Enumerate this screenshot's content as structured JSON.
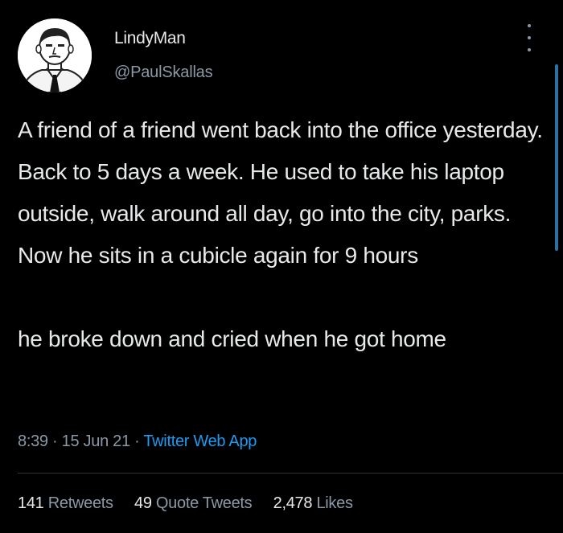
{
  "tweet": {
    "author": {
      "display_name": "LindyMan",
      "handle": "@PaulSkallas"
    },
    "paragraphs": [
      "A friend of a friend went back into the office yesterday. Back to 5 days a week. He used to take his laptop outside, walk around all day, go into the city, parks. Now he sits in a cubicle again for 9 hours",
      "he broke down and cried when he got home"
    ],
    "time": "8:39",
    "separator": "·",
    "date": "15 Jun 21",
    "source": "Twitter Web App",
    "stats": {
      "retweets": {
        "count": "141",
        "label": "Retweets"
      },
      "quote_tweets": {
        "count": "49",
        "label": "Quote Tweets"
      },
      "likes": {
        "count": "2,478",
        "label": "Likes"
      }
    }
  },
  "icons": {
    "more": "more-horizontal-icon",
    "avatar": "cartoon-man-avatar"
  },
  "colors": {
    "background": "#000000",
    "text": "#e7e9ea",
    "secondary": "#8b98a5",
    "link": "#1d9bf0",
    "divider": "#2f3336"
  }
}
